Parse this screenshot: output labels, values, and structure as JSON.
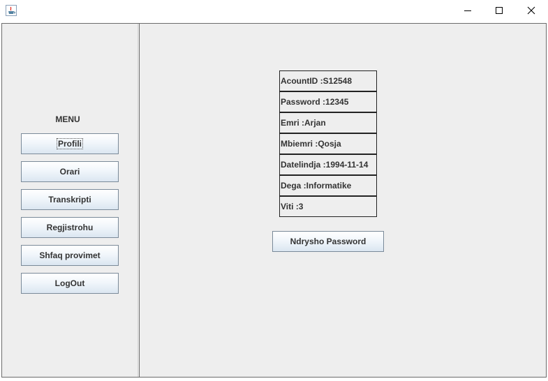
{
  "window": {
    "title": "",
    "controls": {
      "minimize": "minimize-icon",
      "maximize": "maximize-icon",
      "close": "close-icon"
    }
  },
  "sidebar": {
    "menu_label": "MENU",
    "buttons": [
      "Profili",
      "Orari",
      "Transkripti",
      "Regjistrohu",
      "Shfaq provimet",
      "LogOut"
    ]
  },
  "profile": {
    "fields": [
      "AcountID :S12548",
      "Password :12345",
      "Emri :Arjan",
      "Mbiemri :Qosja",
      "Datelindja :1994-11-14",
      "Dega :Informatike",
      "Viti :3"
    ],
    "change_password_label": "Ndrysho Password"
  },
  "colors": {
    "panel_bg": "#eeeeee",
    "button_border": "#7a8a99",
    "text": "#333333"
  }
}
